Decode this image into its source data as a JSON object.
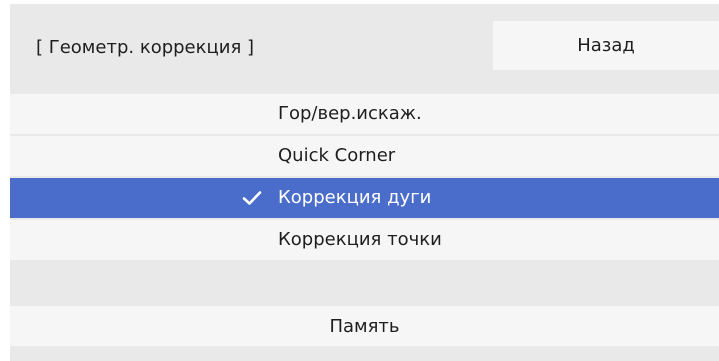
{
  "header": {
    "title": "[ Геометр. коррекция ]",
    "back_label": "Назад"
  },
  "menu": {
    "items": [
      {
        "label": "Гор/вер.искаж.",
        "selected": false
      },
      {
        "label": "Quick Corner",
        "selected": false
      },
      {
        "label": "Коррекция дуги",
        "selected": true
      },
      {
        "label": "Коррекция точки",
        "selected": false
      }
    ]
  },
  "footer": {
    "memory_label": "Память"
  },
  "icons": {
    "check": "check-icon"
  },
  "colors": {
    "panel_background": "#e9e9e9",
    "row_background": "#f6f6f6",
    "selected_background": "#4a6dcb",
    "selected_text": "#ffffff",
    "text": "#1e1e1e"
  }
}
